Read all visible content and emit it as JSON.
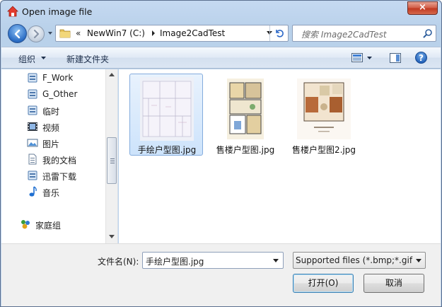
{
  "window": {
    "title": "Open image file",
    "close_label": "×"
  },
  "address_bar": {
    "overflow": "«",
    "crumbs": [
      "NewWin7 (C:)",
      "Image2CadTest"
    ]
  },
  "search": {
    "placeholder": "搜索 Image2CadTest"
  },
  "toolbar": {
    "organize_label": "组织",
    "new_folder_label": "新建文件夹",
    "help_label": "?"
  },
  "sidebar": {
    "items": [
      {
        "label": "F_Work",
        "icon": "library-icon"
      },
      {
        "label": "G_Other",
        "icon": "library-icon"
      },
      {
        "label": "临时",
        "icon": "library-icon"
      },
      {
        "label": "视频",
        "icon": "video-icon"
      },
      {
        "label": "图片",
        "icon": "picture-icon"
      },
      {
        "label": "我的文档",
        "icon": "documents-icon"
      },
      {
        "label": "迅雷下载",
        "icon": "library-icon"
      },
      {
        "label": "音乐",
        "icon": "music-icon"
      }
    ],
    "homegroup": {
      "label": "家庭组",
      "icon": "homegroup-icon"
    }
  },
  "files": [
    {
      "name": "手绘户型图.jpg",
      "selected": true
    },
    {
      "name": "售楼户型图.jpg",
      "selected": false
    },
    {
      "name": "售楼户型图2.jpg",
      "selected": false
    }
  ],
  "bottom": {
    "filename_label": "文件名(N):",
    "filename_value": "手绘户型图.jpg",
    "filetype_value": "Supported files (*.bmp;*.gif;*",
    "open_label": "打开(O)",
    "cancel_label": "取消"
  },
  "colors": {
    "selection_bg": "#cde3fb",
    "selection_border": "#84acdd",
    "close_button": "#c0371f",
    "window_frame": "#b9d1ea"
  }
}
